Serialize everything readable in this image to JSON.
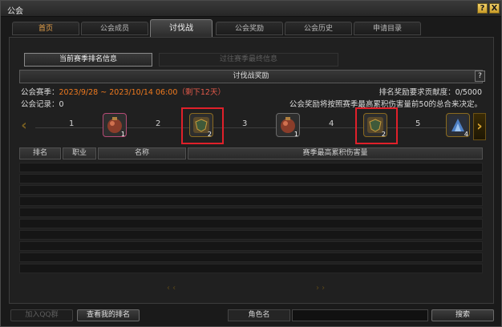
{
  "window": {
    "title": "公会"
  },
  "titlebar": {
    "help_label": "?",
    "close_label": "X"
  },
  "tabs": [
    {
      "label": "首页"
    },
    {
      "label": "公会成员"
    },
    {
      "label": "讨伐战"
    },
    {
      "label": "公会奖励"
    },
    {
      "label": "公会历史"
    },
    {
      "label": "申请目录"
    }
  ],
  "subtabs": {
    "current": "当前赛季排名信息",
    "past": "过往赛季最终信息"
  },
  "reward_bar": {
    "label": "讨伐战奖励",
    "help": "?"
  },
  "season": {
    "label": "公会赛季：",
    "dates": "2023/9/28 ~ 2023/10/14 06:00",
    "remaining": "（剩下12天）",
    "requirement": "排名奖励要求贡献度：0/5000",
    "record": "公会记录：0",
    "note": "公会奖励将按照赛季最高累积伤害量前50的总合来决定。"
  },
  "reward_track": {
    "prev_label": "‹",
    "next_label": "›",
    "ranks": [
      "1",
      "2",
      "3",
      "4",
      "5"
    ],
    "items": [
      {
        "icon": "pouch-icon",
        "count": "1",
        "highlighted": false
      },
      {
        "icon": "shield-chest-icon",
        "count": "2",
        "highlighted": true
      },
      {
        "icon": "pouch-icon",
        "count": "1",
        "highlighted": false
      },
      {
        "icon": "shield-chest-icon",
        "count": "2",
        "highlighted": true
      },
      {
        "icon": "blue-crystal-icon",
        "count": "4",
        "highlighted": false
      }
    ]
  },
  "table": {
    "headers": [
      "排名",
      "职业",
      "名称",
      "赛季最高累积伤害量"
    ]
  },
  "pager": {
    "prev": "‹ ‹",
    "next": "› ›"
  },
  "bottom": {
    "join_qq": "加入QQ群",
    "my_rank": "查看我的排名",
    "char_name_label": "角色名",
    "search_placeholder": "",
    "search": "搜索"
  }
}
